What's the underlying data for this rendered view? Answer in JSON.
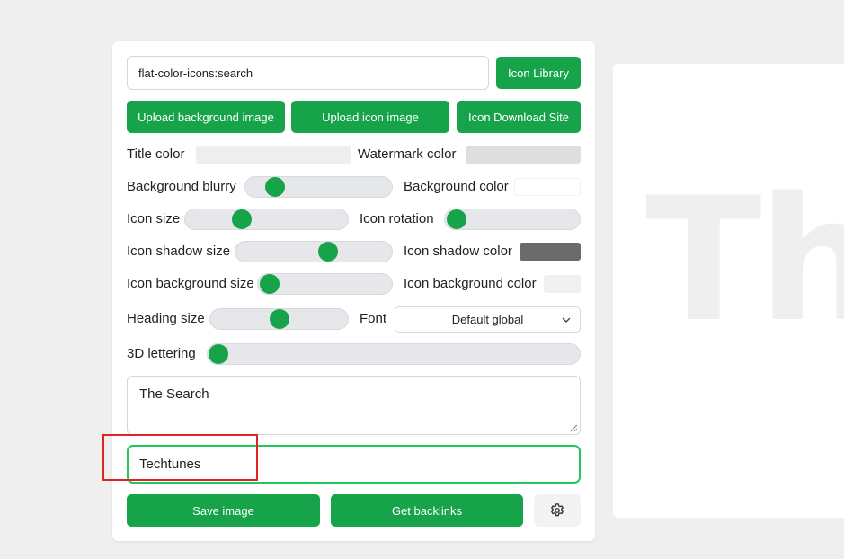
{
  "icon_input": {
    "value": "flat-color-icons:search"
  },
  "buttons": {
    "icon_library": "Icon Library",
    "upload_background": "Upload background image",
    "upload_icon": "Upload icon image",
    "icon_download_site": "Icon Download Site",
    "save_image": "Save image",
    "get_backlinks": "Get backlinks"
  },
  "controls": {
    "title_color": {
      "label": "Title color",
      "color": "#eeeeee"
    },
    "watermark_color": {
      "label": "Watermark color",
      "color": "#dedede"
    },
    "background_blurry": {
      "label": "Background blurry",
      "value": 0.2
    },
    "background_color": {
      "label": "Background color",
      "color": "#ffffff"
    },
    "icon_size": {
      "label": "Icon size",
      "value": 0.35
    },
    "icon_rotation": {
      "label": "Icon rotation",
      "value": 0.0
    },
    "icon_shadow_size": {
      "label": "Icon shadow size",
      "value": 0.59
    },
    "icon_shadow_color": {
      "label": "Icon shadow color",
      "color": "#6b6b6b"
    },
    "icon_background_size": {
      "label": "Icon background size",
      "value": 0.0
    },
    "icon_background_color": {
      "label": "Icon background color",
      "color": "#f0f0f0"
    },
    "heading_size": {
      "label": "Heading size",
      "value": 0.5
    },
    "font": {
      "label": "Font",
      "selected": "Default global"
    },
    "lettering_3d": {
      "label": "3D lettering",
      "value": 0.0
    }
  },
  "title_textarea": {
    "value": "The Search"
  },
  "watermark_input": {
    "value": "Techtunes"
  },
  "preview": {
    "text": "Th"
  },
  "colors": {
    "accent": "#16a34a",
    "focus_border": "#22c55e",
    "highlight": "#e02424"
  },
  "icons": {
    "settings": "gear-icon",
    "dropdown": "chevron-down-icon",
    "resize": "resize-grip-icon"
  }
}
